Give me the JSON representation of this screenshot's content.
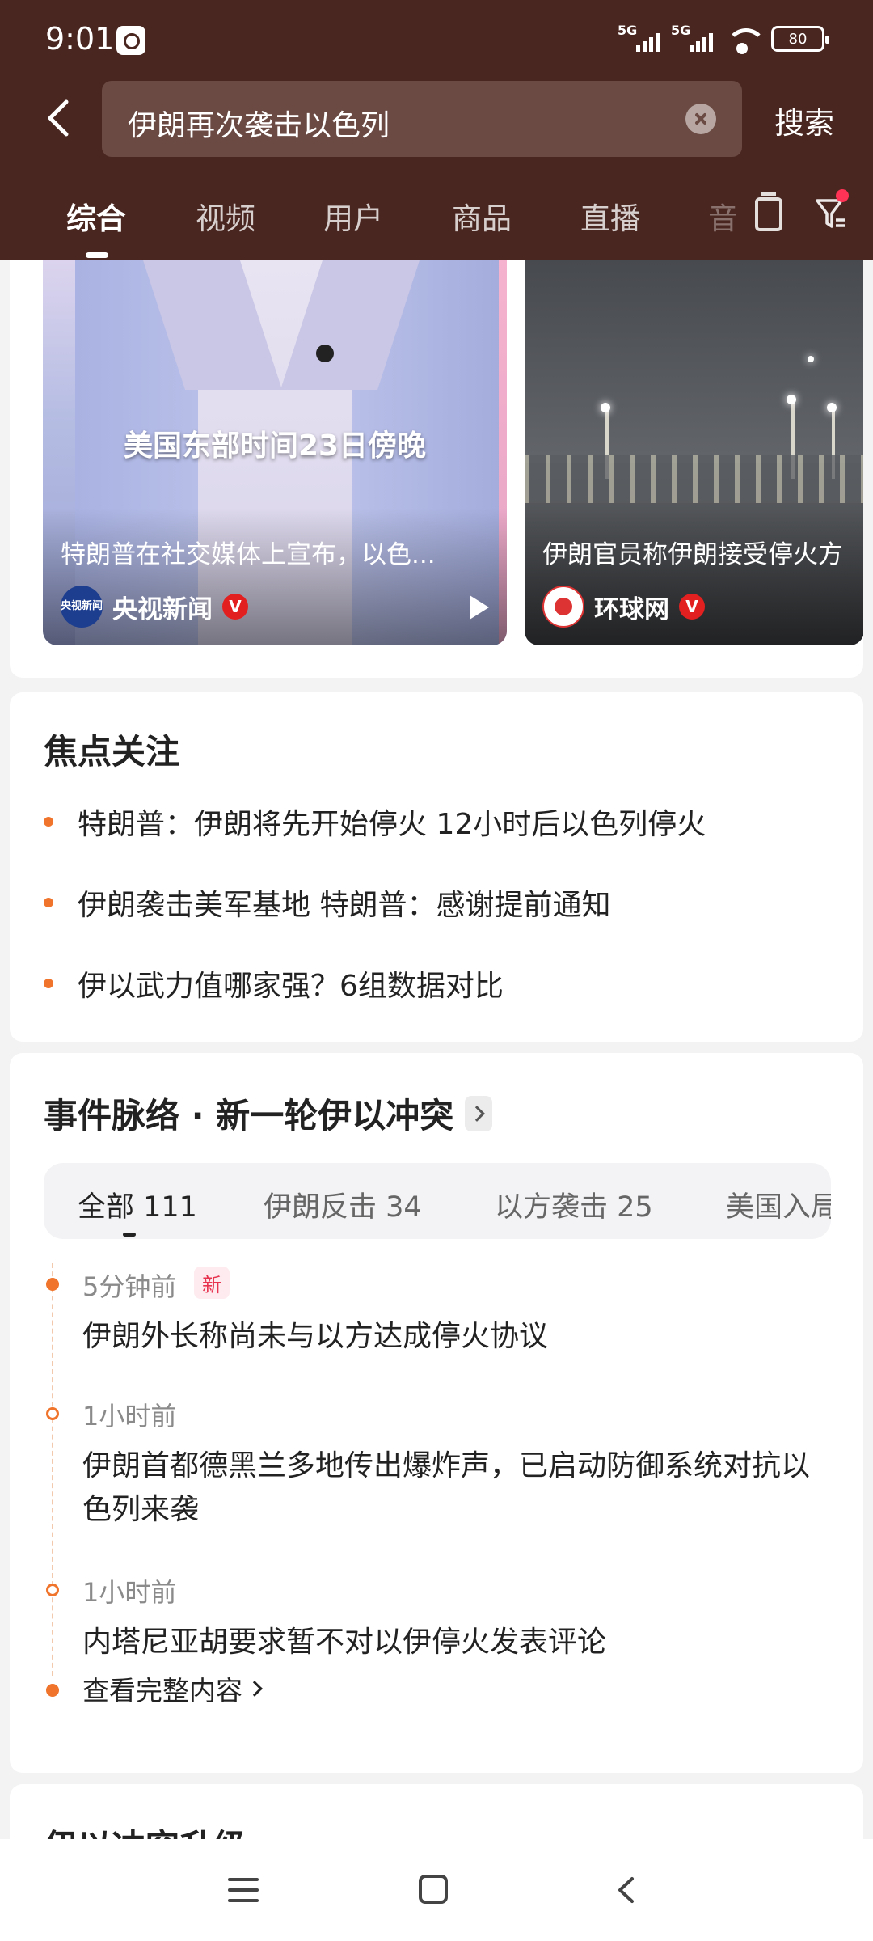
{
  "status_bar": {
    "time": "9:01",
    "signal1": "5G",
    "signal2": "5G",
    "battery": "80"
  },
  "search": {
    "query": "伊朗再次袭击以色列",
    "search_label": "搜索"
  },
  "tabs": [
    {
      "label": "综合",
      "active": true
    },
    {
      "label": "视频"
    },
    {
      "label": "用户"
    },
    {
      "label": "商品"
    },
    {
      "label": "直播"
    },
    {
      "label": "音"
    }
  ],
  "videos": [
    {
      "overlay": "美国东部时间23日傍晚",
      "caption": "特朗普在社交媒体上宣布，以色...",
      "source": "央视新闻",
      "avatar_text": "央视新闻",
      "verified": "V"
    },
    {
      "caption": "伊朗官员称伊朗接受停火方",
      "source": "环球网",
      "verified": "V"
    }
  ],
  "focus": {
    "title": "焦点关注",
    "items": [
      "特朗普：伊朗将先开始停火 12小时后以色列停火",
      "伊朗袭击美军基地 特朗普：感谢提前通知",
      "伊以武力值哪家强？6组数据对比"
    ]
  },
  "timeline": {
    "title": "事件脉络 · 新一轮伊以冲突",
    "filters": [
      "全部 111",
      "伊朗反击 34",
      "以方袭击 25",
      "美国入局"
    ],
    "entries": [
      {
        "time": "5分钟前",
        "badge": "新",
        "text": "伊朗外长称尚未与以方达成停火协议"
      },
      {
        "time": "1小时前",
        "text": "伊朗首都德黑兰多地传出爆炸声，已启动防御系统对抗以色列来袭"
      },
      {
        "time": "1小时前",
        "text": "内塔尼亚胡要求暂不对以伊停火发表评论"
      }
    ],
    "view_all": "查看完整内容"
  },
  "next_card": {
    "title": "伊以冲突升级"
  },
  "colors": {
    "header_bg": "#4a2620",
    "accent": "#f0742b",
    "new_badge": "#e8334f",
    "verified": "#e32020"
  }
}
